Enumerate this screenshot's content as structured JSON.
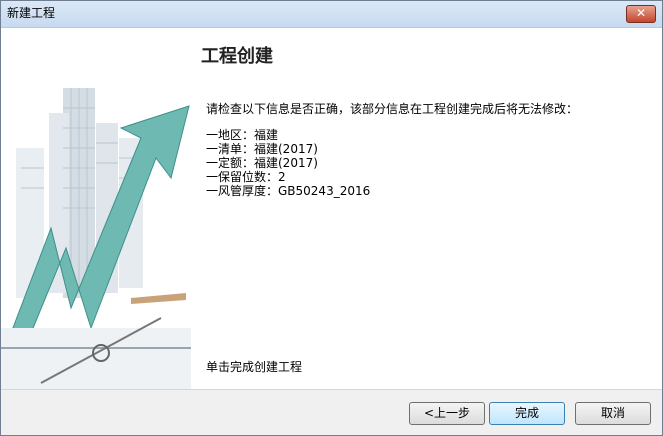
{
  "window": {
    "title": "新建工程",
    "close_label": "✕"
  },
  "page": {
    "heading": "工程创建",
    "instruction": "请检查以下信息是否正确，该部分信息在工程创建完成后将无法修改：",
    "info": [
      "一地区：福建",
      "一清单：福建(2017)",
      "一定额：福建(2017)",
      "一保留位数：2",
      "一风管厚度：GB50243_2016"
    ],
    "finish_hint": "单击完成创建工程"
  },
  "buttons": {
    "back": "<上一步",
    "finish": "完成",
    "cancel": "取消"
  }
}
